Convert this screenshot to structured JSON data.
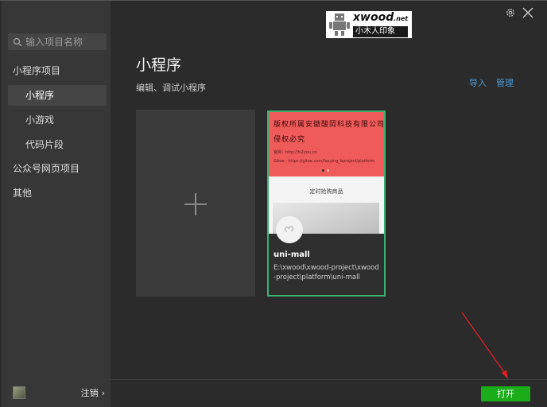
{
  "search": {
    "placeholder": "输入项目名称"
  },
  "sidebar": {
    "items": [
      {
        "label": "小程序项目"
      },
      {
        "label": "小程序"
      },
      {
        "label": "小游戏"
      },
      {
        "label": "代码片段"
      },
      {
        "label": "公众号网页项目"
      },
      {
        "label": "其他"
      }
    ],
    "logout_label": "注销",
    "logout_chevron": "›"
  },
  "main": {
    "title": "小程序",
    "subtitle": "编辑、调试小程序",
    "import_label": "导入",
    "manage_label": "管理"
  },
  "watermark": {
    "title": "xwood",
    "title_suffix": ".net",
    "subtitle": "小木人印象"
  },
  "project": {
    "thumb_line1": "版权所属安徽酸岡科技有限公司",
    "thumb_line2": "侵权必究",
    "thumb_small1": "官网：http://fs2you.cn",
    "thumb_small2": "Gitee：https://gitee.com/faxying_bproject/platform",
    "thumb_caption": "定时抢购商品",
    "name": "uni-mall",
    "path": "E:\\xwood\\xwood-project\\xwood-project\\platform\\uni-mall"
  },
  "footer": {
    "open_label": "打开"
  },
  "colors": {
    "accent": "#1aad19",
    "link": "#4f9bd6",
    "card_border": "#3cb371",
    "arrow": "#e02020"
  }
}
